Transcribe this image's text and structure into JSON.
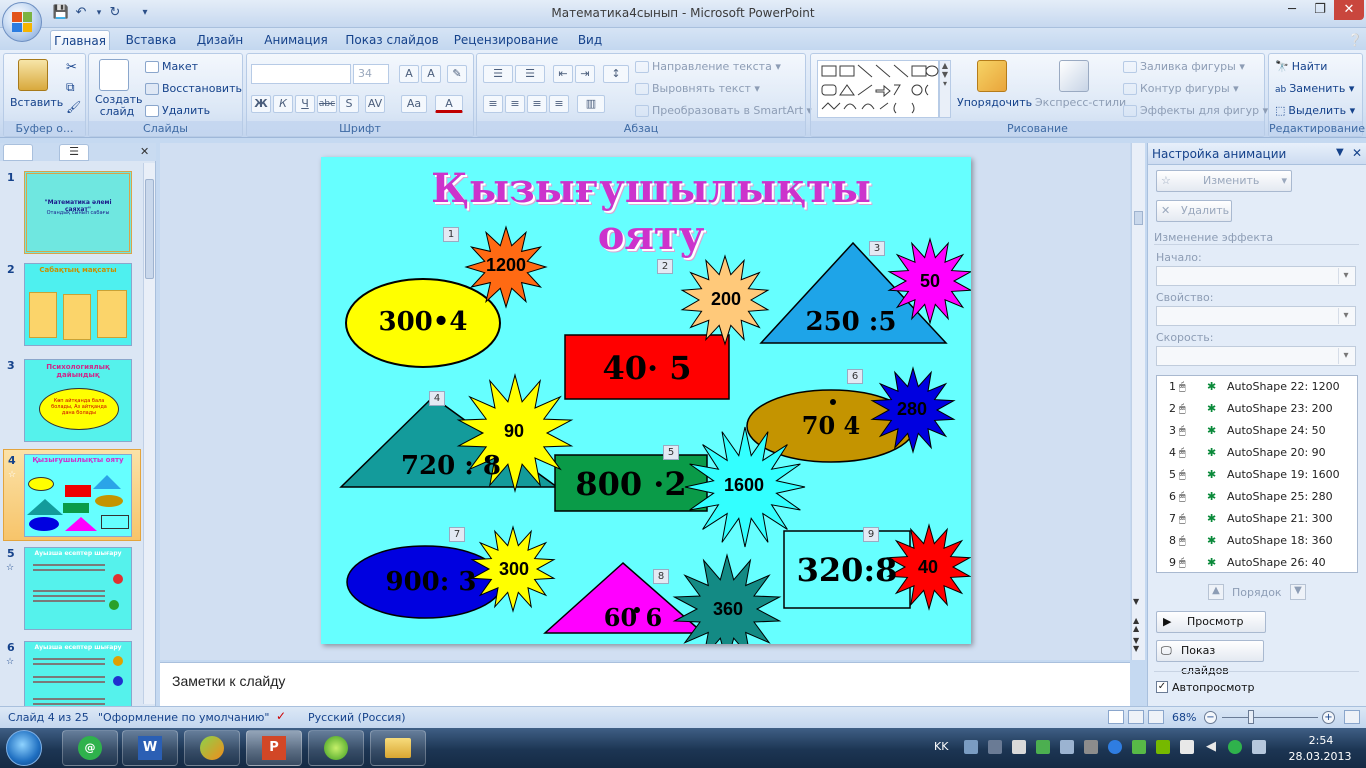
{
  "window": {
    "title": "Математика4сынып  -  Microsoft PowerPoint"
  },
  "tabs": [
    "Главная",
    "Вставка",
    "Дизайн",
    "Анимация",
    "Показ слайдов",
    "Рецензирование",
    "Вид"
  ],
  "ribbon": {
    "clipboard": {
      "paste": "Вставить",
      "label": "Буфер о..."
    },
    "slides": {
      "new_slide": "Создать слайд",
      "layout": "Макет",
      "reset": "Восстановить",
      "delete": "Удалить",
      "label": "Слайды"
    },
    "font": {
      "size": "34",
      "label": "Шрифт"
    },
    "paragraph": {
      "text_direction": "Направление текста",
      "align_text": "Выровнять текст",
      "smartart": "Преобразовать в SmartArt",
      "label": "Абзац"
    },
    "drawing": {
      "arrange": "Упорядочить",
      "quick_styles": "Экспресс-стили",
      "fill": "Заливка фигуры",
      "outline": "Контур фигуры",
      "effects": "Эффекты для фигур",
      "label": "Рисование"
    },
    "editing": {
      "find": "Найти",
      "replace": "Заменить",
      "select": "Выделить",
      "label": "Редактирование"
    }
  },
  "thumbnails": {
    "items": [
      {
        "num": "1",
        "title": "\"Математика әлемі саяхат\"",
        "subtitle": "Отандық сынып сабағы"
      },
      {
        "num": "2",
        "title": "Сабақтың мақсаты",
        "subtitle": ""
      },
      {
        "num": "3",
        "title": "Психологиялық дайындық",
        "subtitle": "Көп айтқанда бала болады, Аз айтқанда дана болады"
      },
      {
        "num": "4",
        "title": "Қызығушылықты ояту",
        "subtitle": ""
      },
      {
        "num": "5",
        "title": "Ауызша есептер шығару",
        "subtitle": ""
      },
      {
        "num": "6",
        "title": "Ауызша есептер шығару",
        "subtitle": ""
      }
    ],
    "active_icon": "☆"
  },
  "slide": {
    "title": "Қызығушылықты ояту",
    "tags": [
      "1",
      "2",
      "3",
      "4",
      "5",
      "6",
      "7",
      "8",
      "9"
    ],
    "problems": [
      "300•4",
      "40· 5",
      "250 :5",
      "70  4",
      "720 : 8",
      "800 ·2",
      "900: 3",
      "60 6",
      "320:8"
    ],
    "answers": [
      "1200",
      "200",
      "50",
      "280",
      "90",
      "1600",
      "300",
      "360",
      "40"
    ],
    "colors": {
      "bg": "#66ffff",
      "title": "#cc33cc"
    }
  },
  "notes": {
    "placeholder": "Заметки к слайду"
  },
  "animation_pane": {
    "title": "Настройка анимации",
    "change": "Изменить",
    "remove": "Удалить",
    "effect_change": "Изменение эффекта",
    "start": "Начало:",
    "property": "Свойство:",
    "speed": "Скорость:",
    "items": [
      {
        "num": "1",
        "label": "AutoShape 22: 1200"
      },
      {
        "num": "2",
        "label": "AutoShape 23: 200"
      },
      {
        "num": "3",
        "label": "AutoShape 24: 50"
      },
      {
        "num": "4",
        "label": "AutoShape 20: 90"
      },
      {
        "num": "5",
        "label": "AutoShape 19: 1600"
      },
      {
        "num": "6",
        "label": "AutoShape 25: 280"
      },
      {
        "num": "7",
        "label": "AutoShape 21: 300"
      },
      {
        "num": "8",
        "label": "AutoShape 18: 360"
      },
      {
        "num": "9",
        "label": "AutoShape 26: 40"
      }
    ],
    "order": "Порядок",
    "preview": "Просмотр",
    "slideshow": "Показ слайдов",
    "autopreview": "Автопросмотр"
  },
  "status": {
    "slide_info": "Слайд 4 из 25",
    "theme": "\"Оформление по умолчанию\"",
    "language": "Русский (Россия)",
    "zoom": "68%"
  },
  "taskbar": {
    "lang": "KK",
    "time": "2:54",
    "date": "28.03.2013"
  }
}
